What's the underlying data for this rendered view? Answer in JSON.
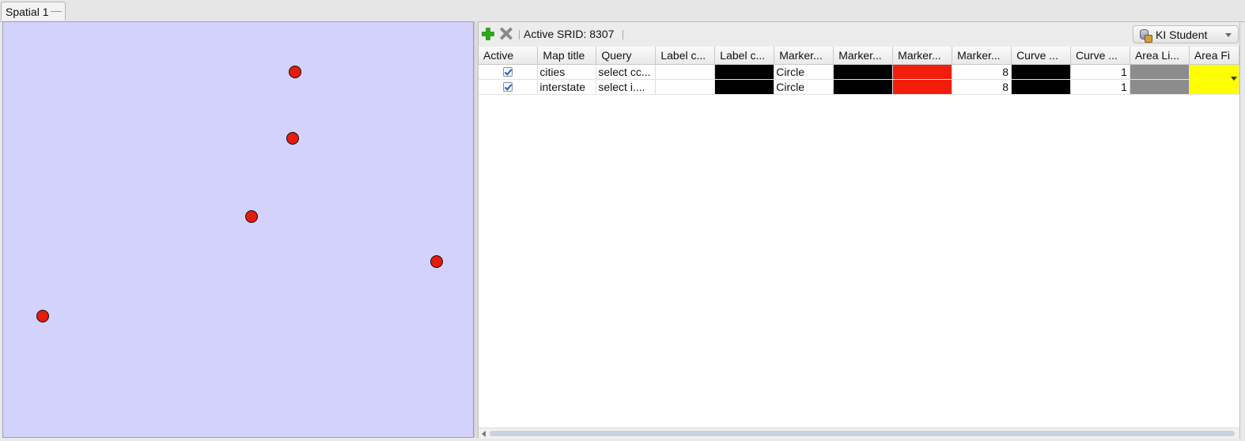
{
  "tabs": [
    {
      "label": "Spatial 1"
    }
  ],
  "map": {
    "background_color": "#d3d2fc",
    "marker_color": "#e51b0c"
  },
  "toolbar": {
    "add_icon": "plus-icon",
    "remove_icon": "x-icon",
    "srid_text": "Active SRID: 8307",
    "connection_label": "KI Student",
    "connection_icon": "database-icon"
  },
  "table": {
    "columns": [
      "Active",
      "Map title",
      "Query",
      "Label c...",
      "Label c...",
      "Marker...",
      "Marker...",
      "Marker...",
      "Marker...",
      "Curve ...",
      "Curve ...",
      "Area Li...",
      "Area Fi"
    ],
    "rows": [
      {
        "active": true,
        "map_title": "cities",
        "query": "select cc...",
        "label_col": "",
        "label_color": "#000000",
        "marker_shape": "Circle",
        "marker_line_color": "#000000",
        "marker_fill_color": "#f21d0a",
        "marker_size": "8",
        "curve_color": "#000000",
        "curve_width": "1",
        "area_line_color": "#8c8c8c",
        "area_fill_color": "#ffff00"
      },
      {
        "active": true,
        "map_title": "interstate",
        "query": "select i....",
        "label_col": "",
        "label_color": "#000000",
        "marker_shape": "Circle",
        "marker_line_color": "#000000",
        "marker_fill_color": "#f21d0a",
        "marker_size": "8",
        "curve_color": "#000000",
        "curve_width": "1",
        "area_line_color": "#8c8c8c",
        "area_fill_color": "#ffff00"
      }
    ]
  }
}
